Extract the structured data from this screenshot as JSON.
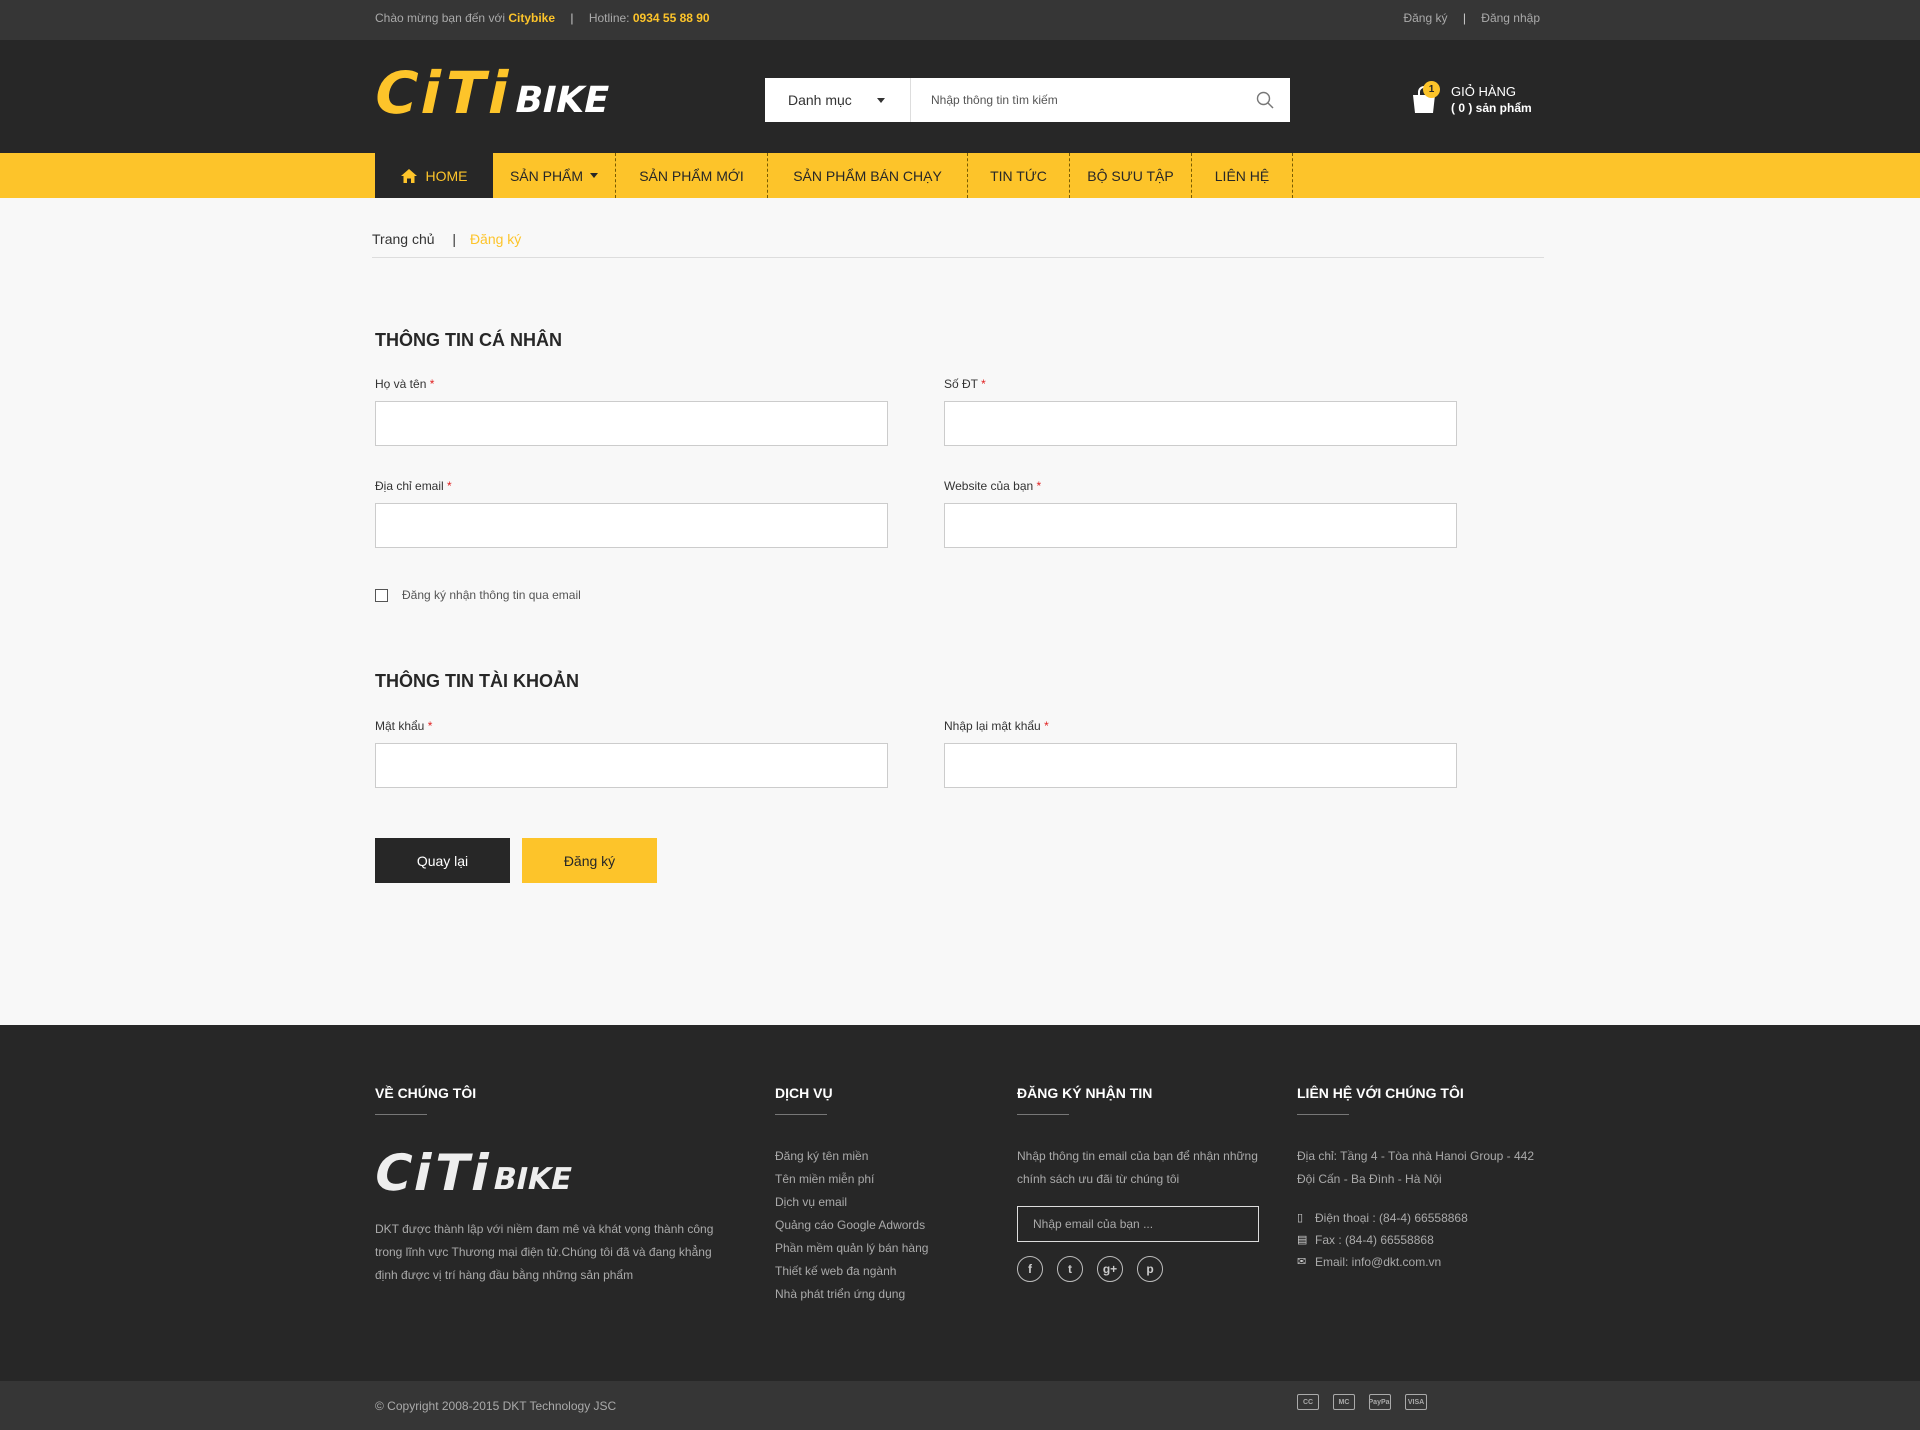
{
  "topbar": {
    "welcome": "Chào mừng bạn đến với",
    "brand": "Citybike",
    "hotline_label": "Hotline:",
    "hotline": "0934 55 88 90",
    "register": "Đăng ký",
    "login": "Đăng nhập"
  },
  "logo": {
    "part1": "CiTi",
    "part2": "BIKE"
  },
  "search": {
    "category": "Danh mục",
    "placeholder": "Nhập thông tin tìm kiếm"
  },
  "cart": {
    "count": "1",
    "title": "GIỎ HÀNG",
    "subtitle": "( 0 ) sản phẩm"
  },
  "nav": {
    "home": "HOME",
    "items": [
      "SẢN PHẨM",
      "SẢN PHẨM MỚI",
      "SẢN PHẨM BÁN CHẠY",
      "TIN TỨC",
      "BỘ SƯU TẬP",
      "LIÊN HỆ"
    ]
  },
  "breadcrumb": {
    "home": "Trang chủ",
    "separator": "|",
    "current": "Đăng ký"
  },
  "personal": {
    "title": "THÔNG TIN CÁ NHÂN",
    "name_label": "Họ và tên",
    "phone_label": "Số ĐT",
    "email_label": "Địa chỉ email",
    "website_label": "Website của bạn",
    "newsletter_label": "Đăng ký nhận thông tin qua email"
  },
  "account": {
    "title": "THÔNG TIN TÀI KHOẢN",
    "password_label": "Mật khẩu",
    "confirm_label": "Nhập lại mật khẩu"
  },
  "required_mark": "*",
  "buttons": {
    "back": "Quay lại",
    "register": "Đăng ký"
  },
  "footer": {
    "about": {
      "title": "VỀ CHÚNG TÔI",
      "text": "DKT được thành lập với niềm đam mê và khát vọng thành công trong lĩnh vực Thương mại điện tử.Chúng tôi đã và đang khẳng định được vị trí hàng đầu bằng những sản phẩm"
    },
    "services": {
      "title": "DỊCH VỤ",
      "items": [
        "Đăng ký tên miền",
        "Tên miền miễn phí",
        "Dịch vụ email",
        "Quảng cáo Google Adwords",
        "Phần mềm quản lý bán hàng",
        "Thiết kế web đa ngành",
        "Nhà phát triển ứng dụng"
      ]
    },
    "newsletter": {
      "title": "ĐĂNG KÝ NHẬN TIN",
      "text": "Nhập thông tin email của bạn để nhận những chính sách ưu đãi từ chúng tôi",
      "placeholder": "Nhập email của bạn ...",
      "social": [
        "f",
        "t",
        "g+",
        "p"
      ]
    },
    "contact": {
      "title": "LIÊN HỆ VỚI CHÚNG TÔI",
      "address": "Địa chỉ: Tầng 4 - Tòa nhà Hanoi Group - 442 Đội Cấn - Ba Đình - Hà Nội",
      "phone": "Điện thoại : (84-4) 66558868",
      "fax": "Fax : (84-4) 66558868",
      "email": "Email: info@dkt.com.vn"
    },
    "copyright": "© Copyright 2008-2015 DKT Technology JSC",
    "payments": [
      "CC",
      "MC",
      "PayPal",
      "VISA"
    ]
  },
  "colors": {
    "accent": "#fdc42a",
    "dark": "#272727",
    "topbar": "#363636"
  }
}
